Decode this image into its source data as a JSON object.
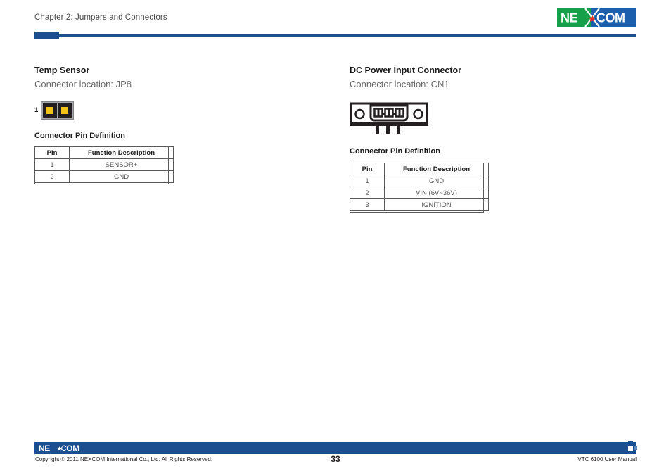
{
  "header": {
    "chapter": "Chapter 2: Jumpers and Connectors",
    "logo_text_left": "NE",
    "logo_text_right": "COM",
    "logo_green": "#17a04a",
    "logo_blue": "#1c5fad",
    "logo_red": "#e03127",
    "rule_color": "#1c4f8f"
  },
  "left_section": {
    "title": "Temp Sensor",
    "location": "Connector location: JP8",
    "jumper": {
      "pin1_label": "1",
      "pad_count": 2,
      "pad_color": "#231f20",
      "core_color": "#f2c318",
      "frame_color": "#a6a8ab"
    },
    "pindef_label": "Connector Pin Definition",
    "table": {
      "columns": [
        "Pin",
        "Function Description"
      ],
      "rows": [
        [
          "1",
          "SENSOR+"
        ],
        [
          "2",
          "GND"
        ]
      ]
    }
  },
  "right_section": {
    "title": "DC Power Input Connector",
    "location": "Connector location: CN1",
    "pindef_label": "Connector Pin Definition",
    "connector_icon": "dc-power-3pin-terminal",
    "table": {
      "columns": [
        "Pin",
        "Function Description"
      ],
      "rows": [
        [
          "1",
          "GND"
        ],
        [
          "2",
          "VIN (6V~36V)"
        ],
        [
          "3",
          "IGNITION"
        ]
      ]
    }
  },
  "footer": {
    "logo_text_left": "NE",
    "logo_text_right": "COM",
    "copyright": "Copyright © 2011 NEXCOM International Co., Ltd. All Rights Reserved.",
    "page_number": "33",
    "manual": "VTC 6100 User Manual",
    "bar_color": "#1c4f8f"
  }
}
